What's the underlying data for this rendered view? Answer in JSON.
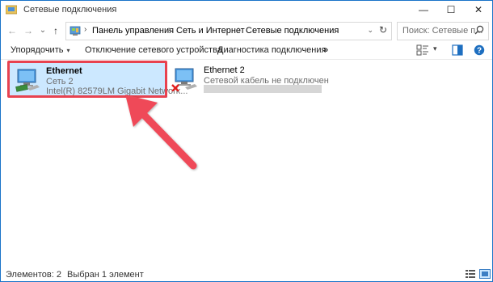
{
  "window": {
    "title": "Сетевые подключения",
    "minimize_glyph": "—",
    "maximize_glyph": "☐",
    "close_glyph": "✕"
  },
  "address_bar": {
    "back_glyph": "←",
    "forward_glyph": "→",
    "dropdown_glyph": "⌄",
    "up_glyph": "↑",
    "breadcrumbs": [
      "Панель управления",
      "Сеть и Интернет",
      "Сетевые подключения"
    ],
    "separator": "›",
    "refresh_glyph": "↻",
    "search_placeholder": "Поиск: Сетевые п..."
  },
  "command_bar": {
    "organize_label": "Упорядочить",
    "organize_caret": "▾",
    "disable_label": "Отключение сетевого устройства",
    "diagnose_label": "Диагностика подключения",
    "more_glyph": "»",
    "view_caret": "▾"
  },
  "connections": [
    {
      "name": "Ethernet",
      "network": "Сеть 2",
      "device": "Intel(R) 82579LM Gigabit Network...",
      "selected": true
    },
    {
      "name": "Ethernet 2",
      "network": "Сетевой кабель не подключен",
      "device": "",
      "disconnected": true
    }
  ],
  "status_bar": {
    "items_label": "Элементов: 2",
    "selected_label": "Выбран 1 элемент"
  },
  "colors": {
    "selection_bg": "#cce8ff",
    "selection_border": "#99d1ff",
    "annotation_red": "#e8424f",
    "window_border": "#1a73c9"
  }
}
